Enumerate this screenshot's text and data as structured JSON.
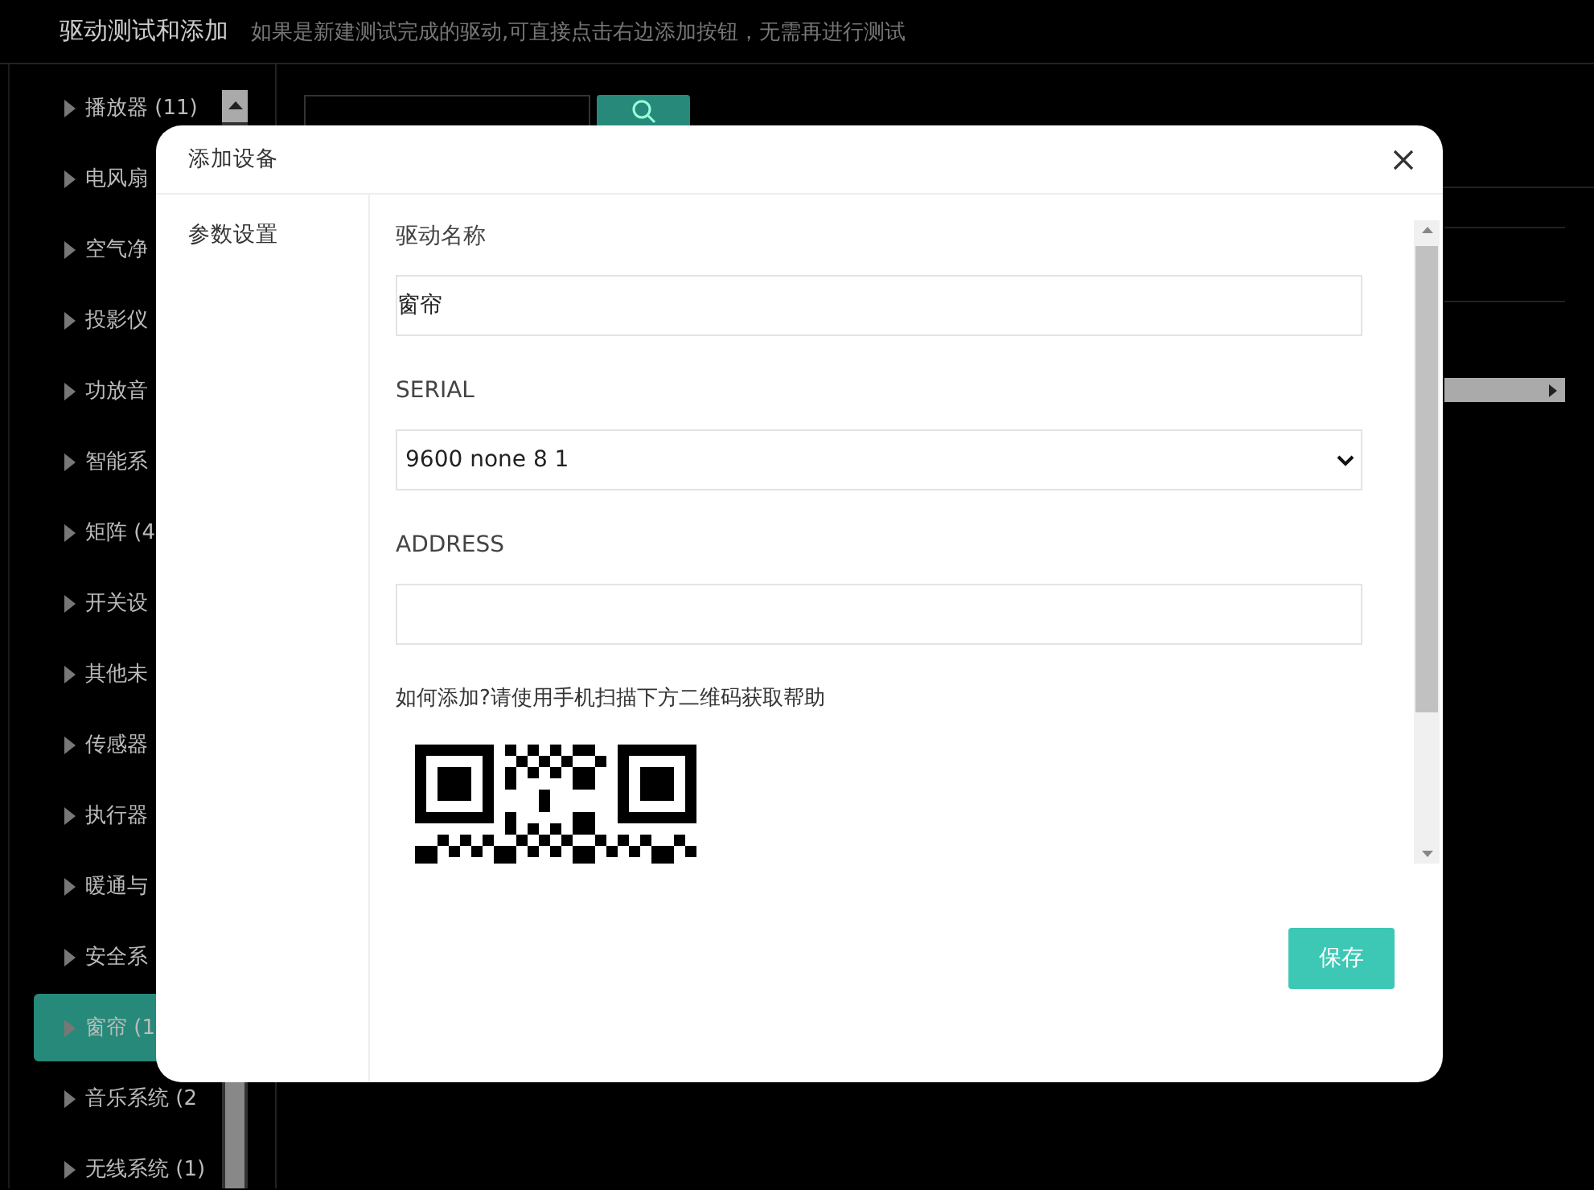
{
  "header": {
    "title": "驱动测试和添加",
    "subtitle": "如果是新建测试完成的驱动,可直接点击右边添加按钮，无需再进行测试"
  },
  "sidebar": {
    "items": [
      {
        "label": "播放器 (11)",
        "selected": false
      },
      {
        "label": "电风扇",
        "selected": false
      },
      {
        "label": "空气净",
        "selected": false
      },
      {
        "label": "投影仪",
        "selected": false
      },
      {
        "label": "功放音",
        "selected": false
      },
      {
        "label": "智能系",
        "selected": false
      },
      {
        "label": "矩阵 (4",
        "selected": false
      },
      {
        "label": "开关设",
        "selected": false
      },
      {
        "label": "其他未",
        "selected": false
      },
      {
        "label": "传感器",
        "selected": false
      },
      {
        "label": "执行器",
        "selected": false
      },
      {
        "label": "暖通与",
        "selected": false
      },
      {
        "label": "安全系",
        "selected": false
      },
      {
        "label": "窗帘 (1",
        "selected": true
      },
      {
        "label": "音乐系统 (2",
        "selected": false
      },
      {
        "label": "无线系统 (1)",
        "selected": false
      }
    ]
  },
  "modal": {
    "title": "添加设备",
    "nav": [
      {
        "label": "参数设置"
      }
    ],
    "fields": [
      {
        "kind": "text",
        "label": "驱动名称",
        "value": "窗帘"
      },
      {
        "kind": "select",
        "label": "SERIAL",
        "value": "9600 none 8 1"
      },
      {
        "kind": "text",
        "label": "ADDRESS"
      }
    ],
    "help": "如何添加?请使用手机扫描下方二维码获取帮助",
    "save_button": "保存"
  }
}
